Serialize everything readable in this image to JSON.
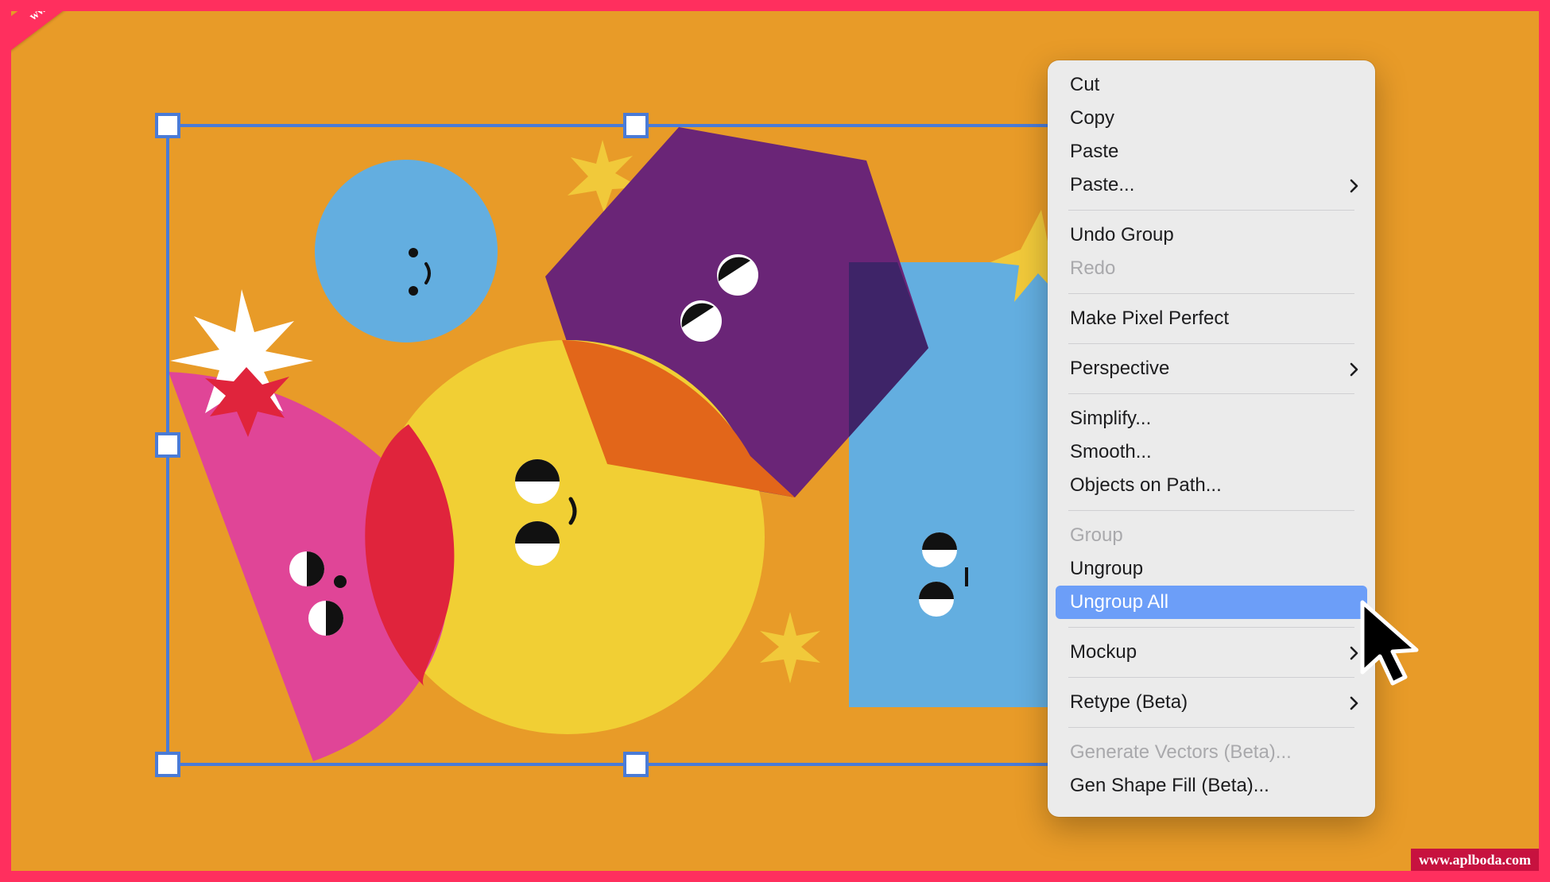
{
  "watermark": {
    "ribbon": "www.aplboda.com",
    "badge": "www.aplboda.com"
  },
  "canvas": {
    "background": "#e89b28",
    "selection_color": "#4a7bd6",
    "shapes": [
      "blue-circle",
      "yellow-circle",
      "pink-quarter-circle",
      "purple-hexagon",
      "blue-rectangle",
      "white-starburst",
      "yellow-stars"
    ]
  },
  "context_menu": {
    "items": [
      {
        "label": "Cut",
        "disabled": false,
        "submenu": false
      },
      {
        "label": "Copy",
        "disabled": false,
        "submenu": false
      },
      {
        "label": "Paste",
        "disabled": false,
        "submenu": false
      },
      {
        "label": "Paste...",
        "disabled": false,
        "submenu": true
      },
      {
        "label": "Undo Group",
        "disabled": false,
        "submenu": false
      },
      {
        "label": "Redo",
        "disabled": true,
        "submenu": false
      },
      {
        "label": "Make Pixel Perfect",
        "disabled": false,
        "submenu": false
      },
      {
        "label": "Perspective",
        "disabled": false,
        "submenu": true
      },
      {
        "label": "Simplify...",
        "disabled": false,
        "submenu": false
      },
      {
        "label": "Smooth...",
        "disabled": false,
        "submenu": false
      },
      {
        "label": "Objects on Path...",
        "disabled": false,
        "submenu": false
      },
      {
        "label": "Group",
        "disabled": true,
        "submenu": false
      },
      {
        "label": "Ungroup",
        "disabled": false,
        "submenu": false
      },
      {
        "label": "Ungroup All",
        "disabled": false,
        "submenu": false,
        "highlighted": true
      },
      {
        "label": "Mockup",
        "disabled": false,
        "submenu": true
      },
      {
        "label": "Retype (Beta)",
        "disabled": false,
        "submenu": true
      },
      {
        "label": "Generate Vectors (Beta)...",
        "disabled": true,
        "submenu": false
      },
      {
        "label": "Gen Shape Fill (Beta)...",
        "disabled": false,
        "submenu": false
      }
    ],
    "highlight_color": "#6c9ef8"
  }
}
